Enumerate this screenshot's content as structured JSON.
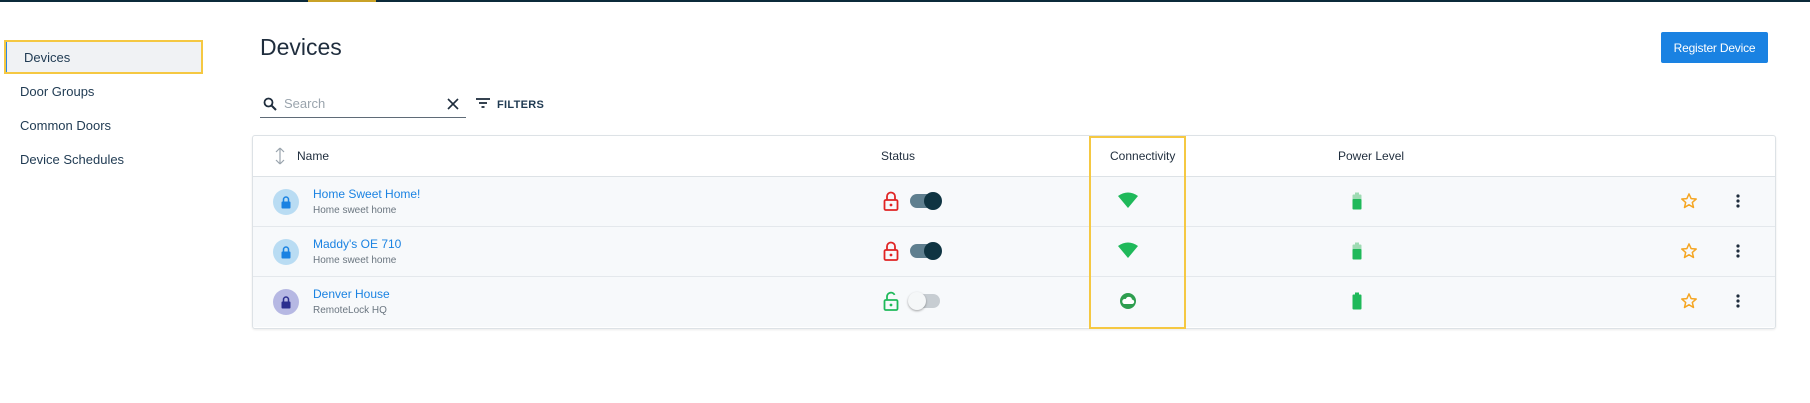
{
  "sidebar": {
    "items": [
      {
        "label": "Devices",
        "active": true
      },
      {
        "label": "Door Groups"
      },
      {
        "label": "Common Doors"
      },
      {
        "label": "Device Schedules"
      }
    ]
  },
  "header": {
    "title": "Devices",
    "register_label": "Register Device"
  },
  "search": {
    "placeholder": "Search",
    "value": ""
  },
  "filters": {
    "label": "FILTERS"
  },
  "table": {
    "columns": {
      "name": "Name",
      "status": "Status",
      "connectivity": "Connectivity",
      "power": "Power Level"
    },
    "rows": [
      {
        "name": "Home Sweet Home!",
        "sub": "Home sweet home",
        "locked": true,
        "toggle_on": true,
        "connectivity": "wifi-icon",
        "battery": "battery-icon-partial"
      },
      {
        "name": "Maddy's OE 710",
        "sub": "Home sweet home",
        "locked": true,
        "toggle_on": true,
        "connectivity": "wifi-icon",
        "battery": "battery-icon-partial"
      },
      {
        "name": "Denver House",
        "sub": "RemoteLock HQ",
        "locked": false,
        "toggle_on": false,
        "connectivity": "cloud-icon",
        "battery": "battery-icon-full"
      }
    ]
  },
  "colors": {
    "accent": "#1a82e2",
    "highlight": "#f5c842",
    "locked": "#e02424",
    "unlocked": "#1fb95a",
    "star": "#f5a623"
  }
}
